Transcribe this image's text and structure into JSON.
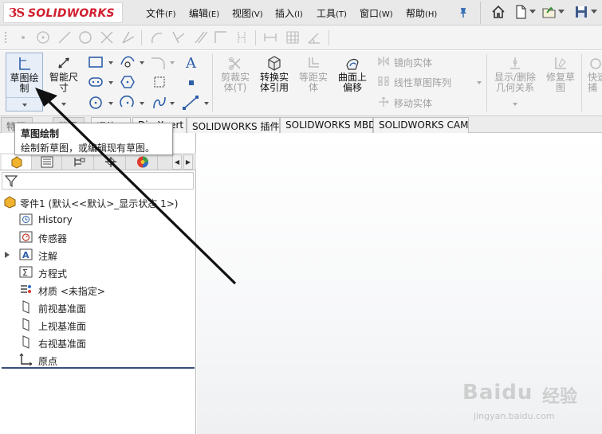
{
  "titlebar": {
    "logo_ds": "3S",
    "logo_text": "SOLIDWORKS",
    "menus": [
      {
        "label": "文件",
        "key": "(F)"
      },
      {
        "label": "编辑",
        "key": "(E)"
      },
      {
        "label": "视图",
        "key": "(V)"
      },
      {
        "label": "插入",
        "key": "(I)"
      },
      {
        "label": "工具",
        "key": "(T)"
      },
      {
        "label": "窗口",
        "key": "(W)"
      },
      {
        "label": "帮助",
        "key": "(H)"
      }
    ],
    "quick_access_icons": [
      "home-icon",
      "new-document-icon",
      "open-folder-icon",
      "save-icon"
    ]
  },
  "ribbon": {
    "sketch_button": "草图绘\n制",
    "smart_dimension": "智能尺\n寸",
    "trim_entities": "剪裁实\n体(T)",
    "convert_entities": "转换实\n体引用",
    "offset_entities": "等距实\n体",
    "offset_on_surface": "曲面上\n偏移",
    "mirror_entities": "镜向实体",
    "linear_pattern": "线性草图阵列",
    "move_entities": "移动实体",
    "display_delete_relations": "显示/删除\n几何关系",
    "repair_sketch": "修复草\n图",
    "quick_snaps": "快速\n捕"
  },
  "command_tabs": [
    {
      "label": "特征"
    },
    {
      "label": "草图"
    },
    {
      "label": "评估"
    },
    {
      "label": "DimXpert"
    },
    {
      "label": "SOLIDWORKS 插件"
    },
    {
      "label": "SOLIDWORKS MBD"
    },
    {
      "label": "SOLIDWORKS CAM"
    }
  ],
  "tooltip": {
    "title": "草图绘制",
    "description": "绘制新草图，或编辑现有草图。"
  },
  "feature_tree": {
    "part_name": "零件1  (默认<<默认>_显示状态 1>)",
    "items": [
      {
        "label": "History",
        "icon": "history-icon"
      },
      {
        "label": "传感器",
        "icon": "sensor-icon"
      },
      {
        "label": "注解",
        "icon": "annotation-icon"
      },
      {
        "label": "方程式",
        "icon": "equation-icon"
      },
      {
        "label": "材质 <未指定>",
        "icon": "material-icon"
      },
      {
        "label": "前视基准面",
        "icon": "plane-icon"
      },
      {
        "label": "上视基准面",
        "icon": "plane-icon"
      },
      {
        "label": "右视基准面",
        "icon": "plane-icon"
      },
      {
        "label": "原点",
        "icon": "origin-icon"
      }
    ]
  },
  "watermark": {
    "brand": "Baidu",
    "product": "经验",
    "url": "jingyan.baidu.com"
  },
  "colors": {
    "brand_red": "#d01f2f",
    "panel_accent": "#3a4f7a",
    "disabled_text": "#a0a0a0"
  }
}
